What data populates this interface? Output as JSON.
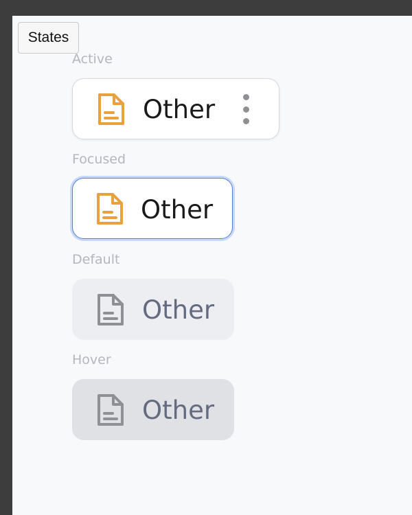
{
  "story_tab": {
    "label": "States"
  },
  "states": [
    {
      "label": "Active",
      "chip_text": "Other",
      "icon": "document-icon",
      "icon_color": "#e9a23b",
      "has_menu": true
    },
    {
      "label": "Focused",
      "chip_text": "Other",
      "icon": "document-icon",
      "icon_color": "#e9a23b",
      "has_menu": false
    },
    {
      "label": "Default",
      "chip_text": "Other",
      "icon": "document-icon",
      "icon_color": "#8e9096",
      "has_menu": false
    },
    {
      "label": "Hover",
      "chip_text": "Other",
      "icon": "document-icon",
      "icon_color": "#8e9096",
      "has_menu": false
    }
  ],
  "colors": {
    "accent_icon": "#e9a23b",
    "muted_icon": "#8e9096",
    "focus_ring": "#4f7fd6",
    "label": "#b3b6bc"
  }
}
